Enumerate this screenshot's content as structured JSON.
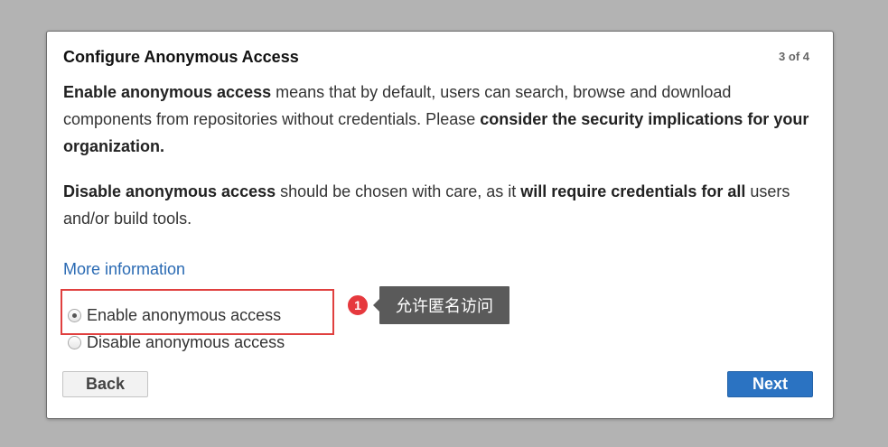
{
  "dialog": {
    "title": "Configure Anonymous Access",
    "step": "3 of 4",
    "paragraph1": {
      "bold1": "Enable anonymous access",
      "text1": " means that by default, users can search, browse and download components from repositories without credentials. Please ",
      "bold2": "consider the security implications for your organization."
    },
    "paragraph2": {
      "bold1": "Disable anonymous access",
      "text1": " should be chosen with care, as it ",
      "bold2": "will require credentials for all",
      "text2": " users and/or build tools."
    },
    "more_info_link": "More information",
    "options": [
      {
        "label": "Enable anonymous access",
        "checked": true
      },
      {
        "label": "Disable anonymous access",
        "checked": false
      }
    ],
    "back_label": "Back",
    "next_label": "Next"
  },
  "annotation": {
    "badge": "1",
    "tooltip": "允许匿名访问",
    "color": "#e6393e"
  },
  "colors": {
    "link": "#2a6ab3",
    "primary_button": "#2b73c2",
    "highlight": "#e0403f"
  }
}
